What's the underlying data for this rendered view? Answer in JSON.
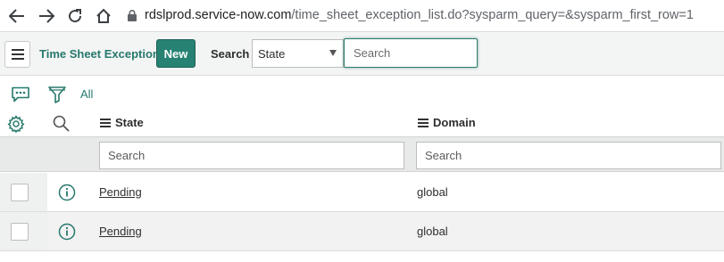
{
  "browser": {
    "url_domain": "rdslprod.service-now.com",
    "url_path": "/time_sheet_exception_list.do?sysparm_query=&sysparm_first_row=1"
  },
  "header": {
    "title": "Time Sheet Exceptions",
    "new_label": "New",
    "search_label": "Search",
    "field_select_value": "State",
    "search_placeholder": "Search"
  },
  "toolbar": {
    "all_label": "All"
  },
  "columns": [
    {
      "label": "State",
      "search_placeholder": "Search"
    },
    {
      "label": "Domain",
      "search_placeholder": "Search"
    }
  ],
  "rows": [
    {
      "state": "Pending",
      "domain": "global"
    },
    {
      "state": "Pending",
      "domain": "global"
    }
  ],
  "colors": {
    "accent": "#278273",
    "title": "#27796d"
  }
}
